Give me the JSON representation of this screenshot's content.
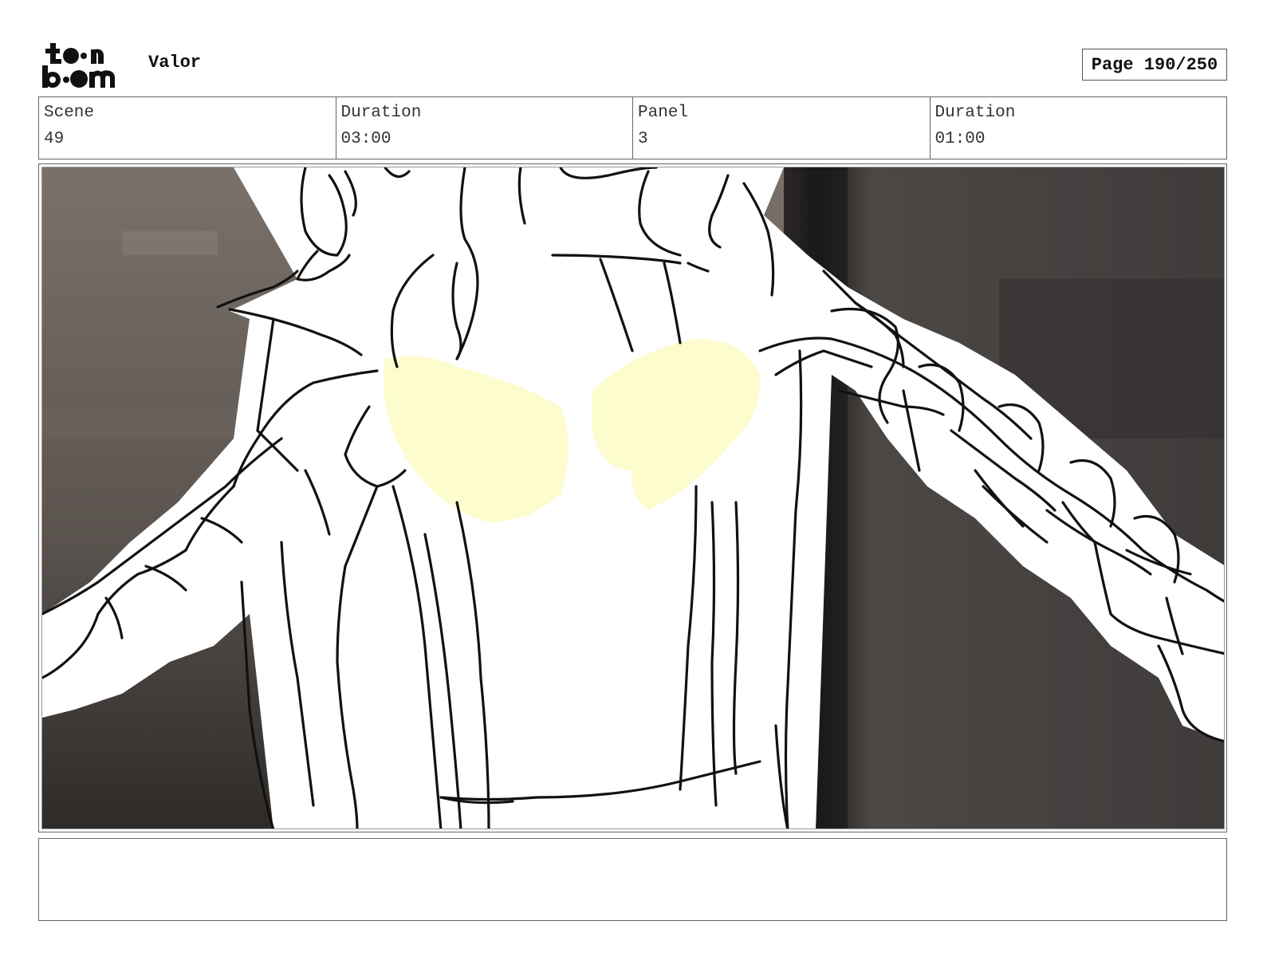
{
  "header": {
    "logo_text": "toon boom",
    "project_title": "Valor",
    "page_counter": "Page 190/250"
  },
  "info": {
    "scene_label": "Scene",
    "scene_value": "49",
    "scene_duration_label": "Duration",
    "scene_duration_value": "03:00",
    "panel_label": "Panel",
    "panel_value": "3",
    "panel_duration_label": "Duration",
    "panel_duration_value": "01:00"
  },
  "notes": {
    "text": ""
  },
  "colors": {
    "highlight": "#fdfccf",
    "background_dark": "#3a3634",
    "background_mid": "#6e6660",
    "line": "#111111"
  }
}
